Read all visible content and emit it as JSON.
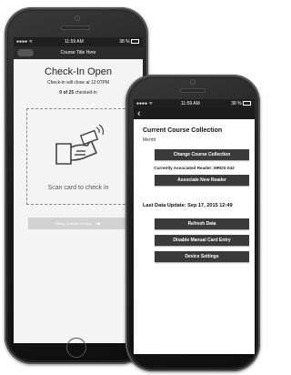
{
  "phone_left": {
    "status": {
      "signal": "●●●● ᯤ",
      "time": "11:59 AM",
      "battery": "38 %"
    },
    "title": "Course Title Here",
    "heading": "Check-In Open",
    "close_note": "Check-in will close at 12:07PM",
    "count_bold": "0 of 25",
    "count_rest": " checked-in",
    "scan_label": "Scan card to check in",
    "setup_button": "Setup in more checkin"
  },
  "phone_right": {
    "status": {
      "signal": "●●●● ᯤ",
      "time": "11:59 AM",
      "battery": "38 %"
    },
    "back_icon": "‹",
    "section_title": "Current Course Collection",
    "collection_name": "Merritt",
    "change_button": "Change Course Collection",
    "reader_text": "Currently Associated Reader: MRDS-042",
    "associate_button": "Associate New Reader",
    "last_update": "Last Data Update: Sep 17, 2015 12:49",
    "refresh_button": "Refresh Data",
    "disable_button": "Disable Manual Card Entry",
    "settings_button": "Device Settings"
  },
  "colors": {
    "dark_button": "#3a3a3a",
    "inactive_button": "#d2d2d2",
    "bar": "#1f1f1f"
  },
  "icons": [
    "back-chevron-icon",
    "hand-card-icon",
    "battery-icon",
    "signal-icon"
  ]
}
